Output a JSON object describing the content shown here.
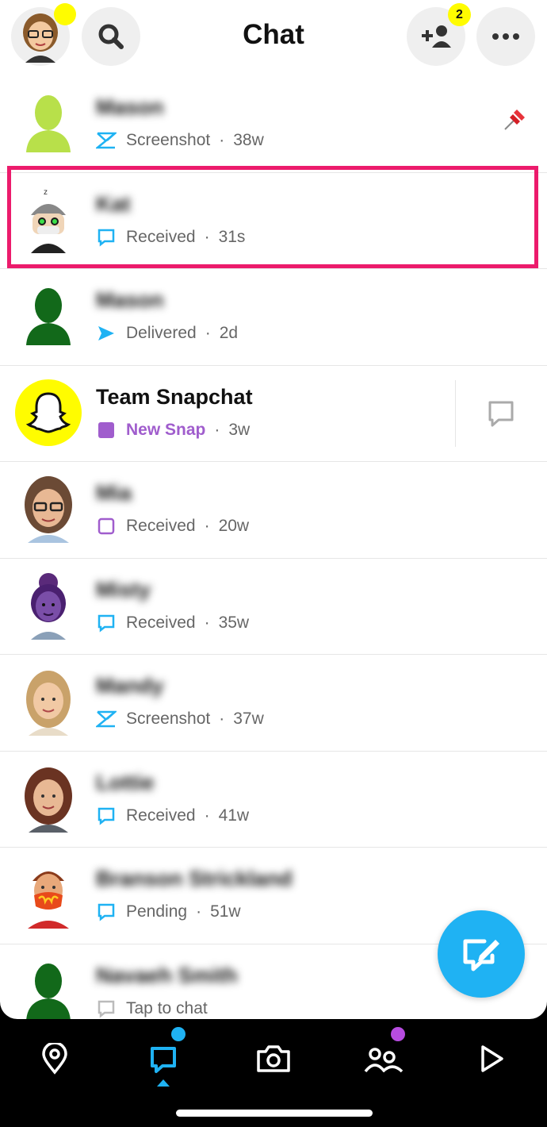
{
  "header": {
    "title": "Chat",
    "friend_request_count": "2"
  },
  "highlight_color": "#ec1b6c",
  "accent_color": "#1fb2f3",
  "chats": [
    {
      "name": "Mason",
      "status": "Screenshot",
      "time": "38w",
      "status_icon": "screenshot-icon",
      "avatar": "silhouette-lime",
      "pinned": true
    },
    {
      "name": "Kat",
      "status": "Received",
      "time": "31s",
      "status_icon": "chat-received-icon",
      "avatar": "bitmoji-robot",
      "highlighted": true
    },
    {
      "name": "Mason",
      "status": "Delivered",
      "time": "2d",
      "status_icon": "sent-arrow-icon",
      "avatar": "silhouette-green"
    },
    {
      "name": "Team Snapchat",
      "status": "New Snap",
      "time": "3w",
      "status_icon": "new-snap-icon",
      "avatar": "snapchat-ghost"
    },
    {
      "name": "Mia",
      "status": "Received",
      "time": "20w",
      "status_icon": "snap-received-icon",
      "avatar": "bitmoji-glasses"
    },
    {
      "name": "Misty",
      "status": "Received",
      "time": "35w",
      "status_icon": "chat-received-icon",
      "avatar": "bitmoji-purple"
    },
    {
      "name": "Mandy",
      "status": "Screenshot",
      "time": "37w",
      "status_icon": "screenshot-icon",
      "avatar": "bitmoji-blonde"
    },
    {
      "name": "Lottie",
      "status": "Received",
      "time": "41w",
      "status_icon": "chat-received-icon",
      "avatar": "bitmoji-brunette"
    },
    {
      "name": "Branson Strickland",
      "status": "Pending",
      "time": "51w",
      "status_icon": "chat-received-icon",
      "avatar": "bitmoji-flame"
    },
    {
      "name": "Navaeh Smith",
      "status": "Tap to chat",
      "time": "",
      "status_icon": "tap-to-chat-icon",
      "avatar": "silhouette-green"
    }
  ],
  "nav": [
    "map-icon",
    "chat-icon",
    "camera-icon",
    "friends-icon",
    "spotlight-icon"
  ]
}
